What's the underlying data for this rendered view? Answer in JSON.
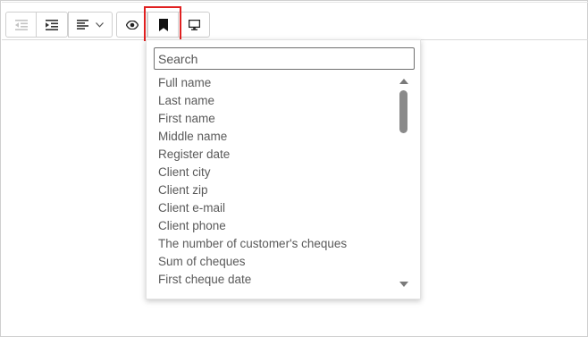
{
  "toolbar": {
    "buttons": [
      {
        "name": "outdent",
        "icon": "outdent-icon"
      },
      {
        "name": "indent",
        "icon": "indent-icon"
      },
      {
        "name": "align",
        "icon": "align-left-icon",
        "dropdown_icon": "chevron-down-icon"
      },
      {
        "name": "preview",
        "icon": "eye-icon"
      },
      {
        "name": "bookmark",
        "icon": "bookmark-icon",
        "highlighted": true
      },
      {
        "name": "monitor",
        "icon": "monitor-icon"
      }
    ],
    "highlight_color": "#e02020"
  },
  "dropdown": {
    "search_placeholder": "Search",
    "items": [
      "Full name",
      "Last name",
      "First name",
      "Middle name",
      "Register date",
      "Client city",
      "Client zip",
      "Client e-mail",
      "Client phone",
      "The number of customer's cheques",
      "Sum of cheques",
      "First cheque date"
    ]
  }
}
